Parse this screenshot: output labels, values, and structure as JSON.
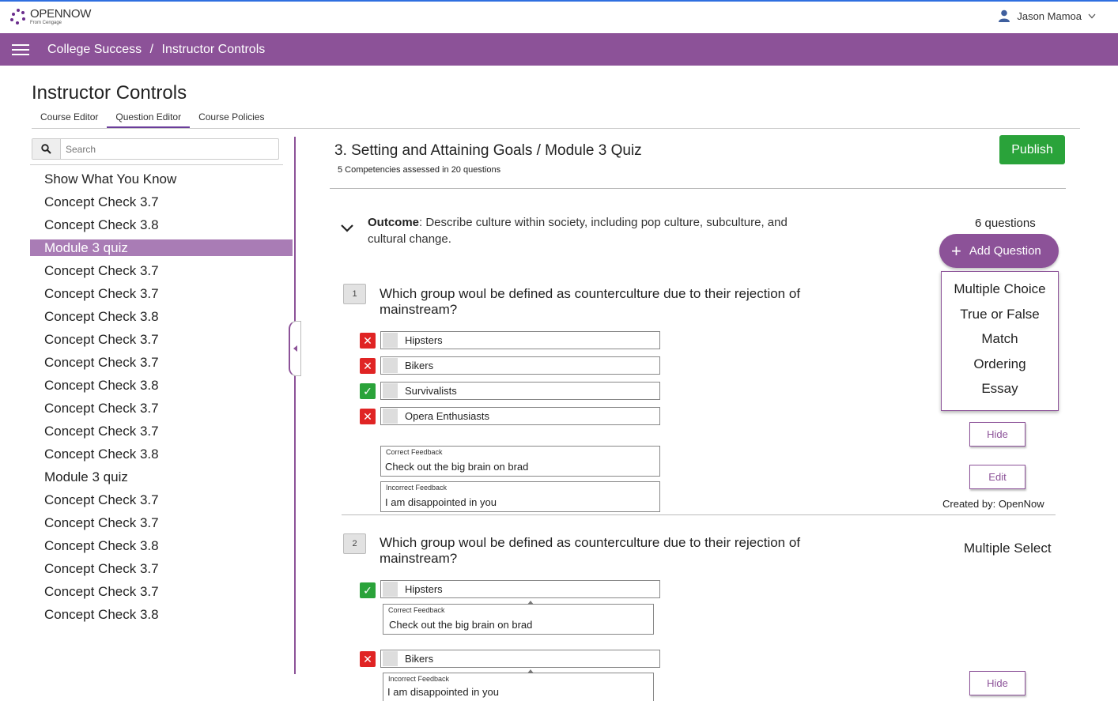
{
  "app": {
    "logo_name": "OPENNOW",
    "logo_sub": "From Cengage",
    "logo_color": "#6a2c8c"
  },
  "user": {
    "name": "Jason Mamoa"
  },
  "breadcrumb": {
    "course": "College Success",
    "separator": "/",
    "page": "Instructor Controls"
  },
  "page": {
    "title": "Instructor Controls",
    "tabs": [
      {
        "label": "Course Editor",
        "active": false
      },
      {
        "label": "Question Editor",
        "active": true
      },
      {
        "label": "Course Policies",
        "active": false
      }
    ]
  },
  "sidebar": {
    "search_placeholder": "Search",
    "items": [
      "Show What You Know",
      "Concept Check 3.7",
      "Concept Check 3.8",
      "Module 3 quiz",
      "Concept Check 3.7",
      "Concept Check 3.7",
      "Concept Check 3.8",
      "Concept Check 3.7",
      "Concept Check 3.7",
      "Concept Check 3.8",
      "Concept Check 3.7",
      "Concept Check 3.7",
      "Concept Check 3.8",
      "Module 3 quiz",
      "Concept Check 3.7",
      "Concept Check 3.7",
      "Concept Check 3.8",
      "Concept Check 3.7",
      "Concept Check 3.7",
      "Concept Check 3.8"
    ],
    "active_index": 3
  },
  "main": {
    "title": "3. Setting and Attaining Goals / Module 3 Quiz",
    "subtitle": "5 Competencies assessed in 20 questions",
    "publish_label": "Publish",
    "outcome_label": "Outcome",
    "outcome_text": ": Describe culture within society, including pop culture, subculture, and cultural change.",
    "question_count": "6 questions",
    "add_question_label": "Add Question",
    "question_types": [
      "Multiple Choice",
      "True or False",
      "Match",
      "Ordering",
      "Essay"
    ],
    "hide_label": "Hide",
    "edit_label": "Edit",
    "created_by": "Created by: OpenNow",
    "q1": {
      "number": "1",
      "text": "Which group woul be defined as counterculture due to their rejection of mainstream?",
      "answers": [
        {
          "text": "Hipsters",
          "correct": false
        },
        {
          "text": "Bikers",
          "correct": false
        },
        {
          "text": "Survivalists",
          "correct": true
        },
        {
          "text": "Opera Enthusiasts",
          "correct": false
        }
      ],
      "correct_feedback_label": "Correct Feedback",
      "correct_feedback": "Check out the big brain on brad",
      "incorrect_feedback_label": "Incorrect Feedback",
      "incorrect_feedback": "I am disappointed in you"
    },
    "q2": {
      "number": "2",
      "type": "Multiple Select",
      "text": "Which group woul be defined as counterculture due to their rejection of mainstream?",
      "answers": [
        {
          "text": "Hipsters",
          "correct": true,
          "feedback_label": "Correct Feedback",
          "feedback": "Check out the big brain on brad"
        },
        {
          "text": "Bikers",
          "correct": false,
          "feedback_label": "Incorrect Feedback",
          "feedback": "I am disappointed in you"
        }
      ]
    }
  }
}
